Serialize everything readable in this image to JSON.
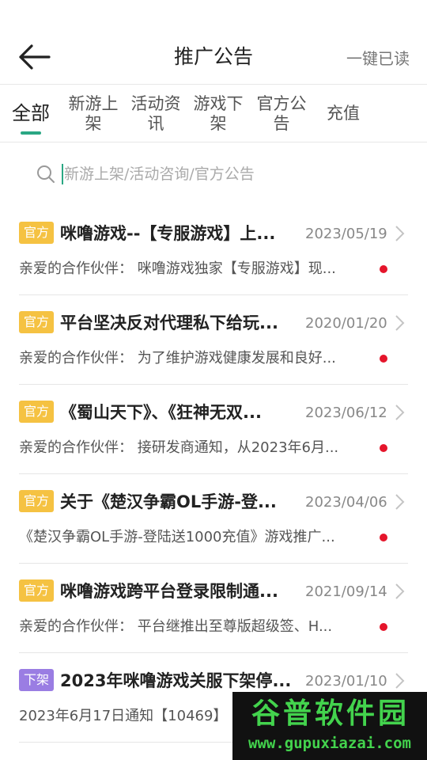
{
  "header": {
    "title": "推广公告",
    "mark_all_read": "一键已读",
    "back_icon": "arrow-left-icon"
  },
  "tabs": [
    {
      "label": "全部",
      "active": true
    },
    {
      "label": "新游上架"
    },
    {
      "label": "活动资讯"
    },
    {
      "label": "游戏下架"
    },
    {
      "label": "官方公告"
    },
    {
      "label": "充值"
    }
  ],
  "search": {
    "placeholder": "新游上架/活动咨询/官方公告",
    "value": ""
  },
  "announcements": [
    {
      "tag": "官方",
      "tag_type": "official",
      "title": "咪噜游戏--【专服游戏】上...",
      "date": "2023/05/19",
      "summary": "亲爱的合作伙伴： 咪噜游戏独家【专服游戏】现...",
      "unread": true
    },
    {
      "tag": "官方",
      "tag_type": "official",
      "title": "平台坚决反对代理私下给玩...",
      "date": "2020/01/20",
      "summary": "亲爱的合作伙伴： 为了维护游戏健康发展和良好...",
      "unread": true
    },
    {
      "tag": "官方",
      "tag_type": "official",
      "title": "《蜀山天下》、《狂神无双...",
      "date": "2023/06/12",
      "summary": "亲爱的合作伙伴： 接研发商通知，从2023年6月...",
      "unread": true
    },
    {
      "tag": "官方",
      "tag_type": "official",
      "title": "关于《楚汉争霸OL手游-登...",
      "date": "2023/04/06",
      "summary": "《楚汉争霸OL手游-登陆送1000充值》游戏推广...",
      "unread": true
    },
    {
      "tag": "官方",
      "tag_type": "official",
      "title": "咪噜游戏跨平台登录限制通...",
      "date": "2021/09/14",
      "summary": "亲爱的合作伙伴： 平台继推出至尊版超级签、H...",
      "unread": true
    },
    {
      "tag": "下架",
      "tag_type": "offline",
      "title": "2023年咪噜游戏关服下架停...",
      "date": "2023/01/10",
      "summary": "2023年6月17日通知【10469】",
      "unread": false
    }
  ],
  "watermark": {
    "logo_text": "谷普软件园",
    "url": "www.gupuxiazai.com"
  },
  "colors": {
    "accent": "#2aa783",
    "official_badge": "#f5c242",
    "offline_badge": "#9a7de3",
    "unread_dot": "#e5152b"
  }
}
